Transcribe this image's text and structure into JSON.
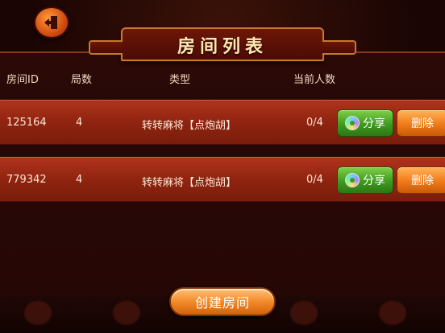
{
  "header": {
    "title": "房间列表"
  },
  "table": {
    "columns": [
      "房间ID",
      "局数",
      "类型",
      "当前人数"
    ],
    "rows": [
      {
        "room_id": "125164",
        "rounds": "4",
        "type": "转转麻将【点炮胡】",
        "players": "0/4",
        "share_label": "分享",
        "delete_label": "删除"
      },
      {
        "room_id": "779342",
        "rounds": "4",
        "type": "转转麻将【点炮胡】",
        "players": "0/4",
        "share_label": "分享",
        "delete_label": "删除"
      }
    ]
  },
  "footer": {
    "create_label": "创建房间"
  },
  "colors": {
    "accent": "#f28a2a",
    "row_red": "#a02a14",
    "share_green": "#3f9a1f"
  }
}
